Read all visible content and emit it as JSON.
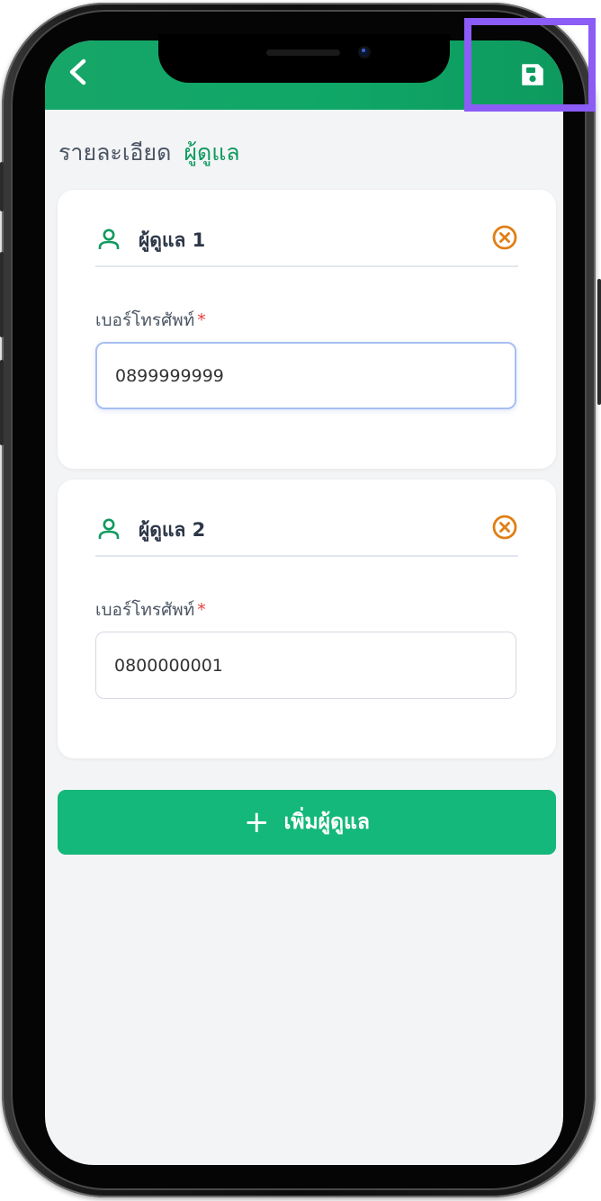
{
  "header": {
    "back_icon": "chevron-left-icon",
    "save_icon": "floppy-disk-save-icon",
    "bg_color": "#0fa767"
  },
  "breadcrumb": {
    "section": "รายละเอียด",
    "current": "ผู้ดูแล"
  },
  "caregivers": [
    {
      "title": "ผู้ดูแล 1",
      "phone_label": "เบอร์โทรศัพท์",
      "required_mark": "*",
      "phone_value": "0899999999"
    },
    {
      "title": "ผู้ดูแล 2",
      "phone_label": "เบอร์โทรศัพท์",
      "required_mark": "*",
      "phone_value": "0800000001"
    }
  ],
  "add_button": {
    "icon": "+",
    "label": "เพิ่มผู้ดูแล",
    "color": "#14b87a"
  },
  "colors": {
    "accent": "#0e9a5e",
    "remove_icon": "#e07f16",
    "highlight_box": "#8b5cf6"
  }
}
